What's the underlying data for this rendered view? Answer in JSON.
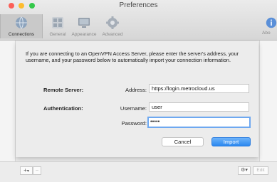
{
  "window": {
    "title": "Preferences"
  },
  "toolbar": {
    "items": [
      {
        "label": "Connections",
        "icon": "globe-network-icon",
        "active": true
      },
      {
        "label": "General",
        "icon": "grid-icon",
        "active": false
      },
      {
        "label": "Appearance",
        "icon": "monitor-icon",
        "active": false
      },
      {
        "label": "Advanced",
        "icon": "gear-icon",
        "active": false
      },
      {
        "label": "Abo",
        "icon": "info-icon",
        "active": false
      }
    ]
  },
  "sheet": {
    "message": "If you are connecting to an OpenVPN Access Server, please enter the server's address, your username, and your password below to automatically import your connection information.",
    "remote_server_label": "Remote Server:",
    "address_label": "Address:",
    "address_value": "https://login.metrocloud.us",
    "authentication_label": "Authentication:",
    "username_label": "Username:",
    "username_value": "user",
    "password_label": "Password:",
    "password_value": "•••••",
    "cancel_label": "Cancel",
    "import_label": "Import"
  },
  "bottombar": {
    "add_label": "+",
    "dropdown_label": "▾",
    "remove_label": "−",
    "gear_label": "⚙▾",
    "edit_label": "Edit"
  },
  "colors": {
    "accent": "#2c88f0",
    "focus_ring": "#6ea8f0"
  }
}
